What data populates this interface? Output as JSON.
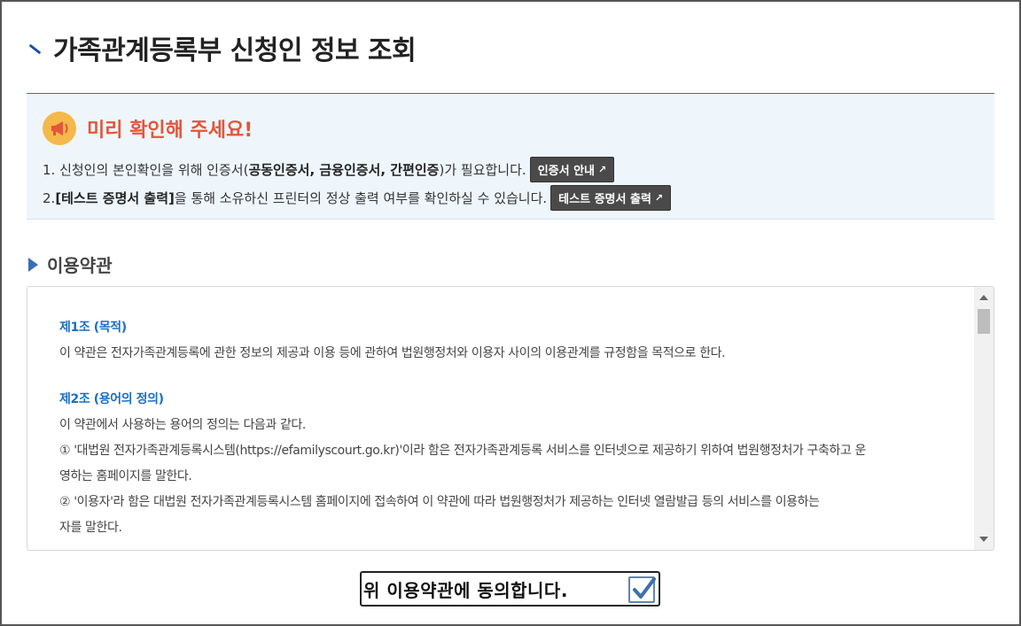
{
  "page": {
    "title": "가족관계등록부 신청인 정보 조회"
  },
  "notice": {
    "headline": "미리 확인해 주세요!",
    "line1": {
      "prefix": "1. 신청인의 본인확인을 위해 인증서(",
      "bold": "공동인증서, 금융인증서, 간편인증",
      "suffix": ")가 필요합니다.",
      "button": "인증서 안내"
    },
    "line2": {
      "prefix": "2. ",
      "bold": "[테스트 증명서 출력]",
      "suffix": "을 통해 소유하신 프린터의 정상 출력 여부를 확인하실 수 있습니다.",
      "button": "테스트 증명서 출력"
    }
  },
  "terms": {
    "title": "이용약관",
    "article1": {
      "heading": "제1조 (목적)",
      "text": "이 약관은 전자가족관계등록에 관한 정보의 제공과 이용 등에 관하여 법원행정처와 이용자 사이의 이용관계를 규정함을 목적으로 한다."
    },
    "article2": {
      "heading": "제2조 (용어의 정의)",
      "intro": "이 약관에서 사용하는 용어의 정의는 다음과 같다.",
      "item1_l1": "① '대법원 전자가족관계등록시스템(https://efamilyscourt.go.kr)'이라 함은 전자가족관계등록 서비스를 인터넷으로 제공하기 위하여 법원행정처가 구축하고 운",
      "item1_l2": "영하는 홈페이지를 말한다.",
      "item2_l1": "② '이용자'라 함은 대법원 전자가족관계등록시스템 홈페이지에 접속하여 이 약관에 따라 법원행정처가 제공하는 인터넷 열람발급 등의 서비스를 이용하는",
      "item2_l2": "자를 말한다."
    }
  },
  "agree": {
    "label": "위 이용약관에 동의합니다.",
    "checked": true
  },
  "colors": {
    "accent": "#1e4ea1",
    "alert": "#e4553a",
    "link": "#1a6fc4",
    "notice_bg": "#eef6fc"
  }
}
